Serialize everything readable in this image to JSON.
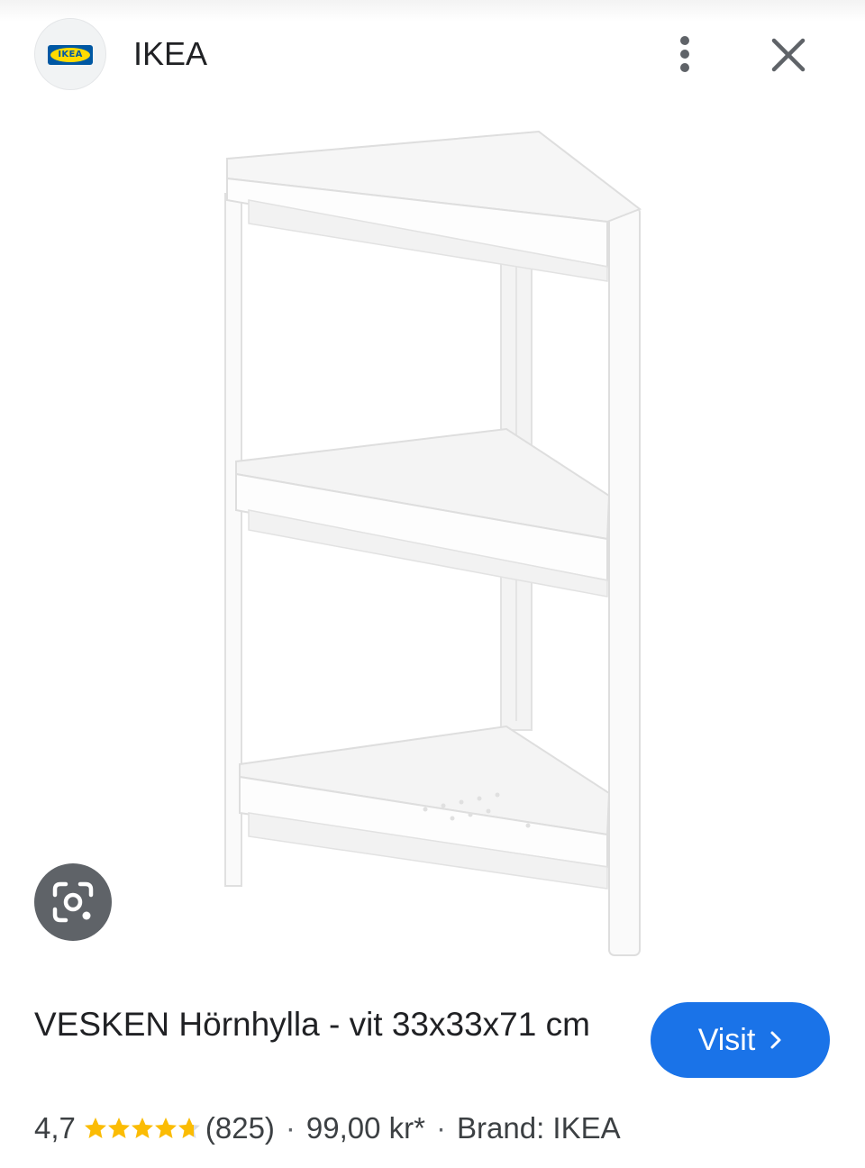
{
  "header": {
    "site_name": "IKEA",
    "logo_text": "IKEA",
    "more_icon": "more-vert-icon",
    "close_icon": "close-icon"
  },
  "image": {
    "lens_icon": "lens-icon"
  },
  "product": {
    "title": "VESKEN Hörnhylla - vit 33x33x71 cm",
    "rating": "4,7",
    "stars": 4.7,
    "reviews": "(825)",
    "separator": "·",
    "price": "99,00 kr*",
    "brand": "Brand: IKEA"
  },
  "visit_button": {
    "label": "Visit"
  },
  "colors": {
    "accent": "#1a73e8",
    "star": "#fbbc04",
    "lens_button": "#5f6368"
  }
}
